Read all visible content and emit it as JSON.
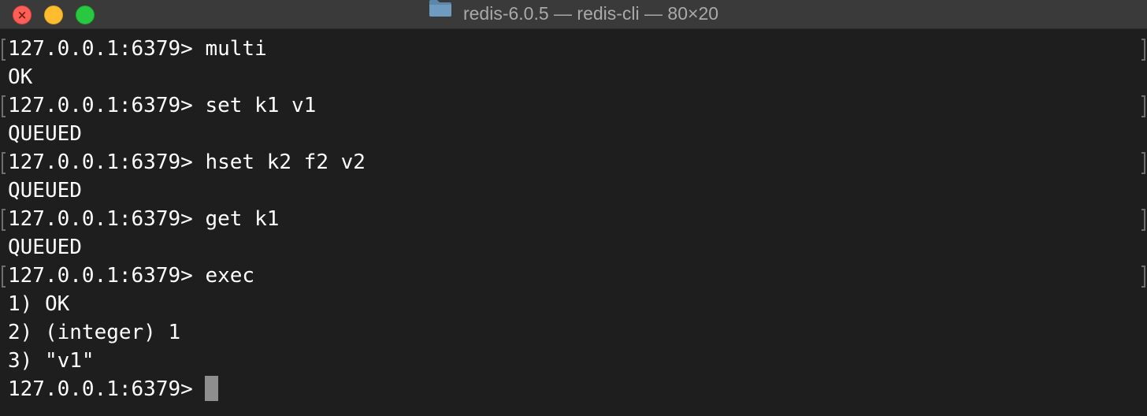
{
  "window": {
    "title": "redis-6.0.5 — redis-cli — 80×20",
    "title_icon": "folder-icon",
    "controls": [
      "close",
      "minimize",
      "zoom"
    ]
  },
  "terminal": {
    "lines": [
      "127.0.0.1:6379> multi",
      "OK",
      "127.0.0.1:6379> set k1 v1",
      "QUEUED",
      "127.0.0.1:6379> hset k2 f2 v2",
      "QUEUED",
      "127.0.0.1:6379> get k1",
      "QUEUED",
      "127.0.0.1:6379> exec",
      "1) OK",
      "2) (integer) 1",
      "3) \"v1\""
    ],
    "prompt": "127.0.0.1:6379> "
  },
  "colors": {
    "background": "#1e1e1e",
    "titlebar": "#3a3a3a",
    "text": "#ffffff",
    "cursor": "#8e8e8e"
  }
}
